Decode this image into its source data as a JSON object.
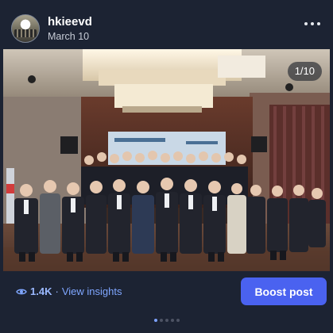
{
  "post": {
    "username": "hkieevd",
    "date": "March 10"
  },
  "photo": {
    "counter": "1/10"
  },
  "footer": {
    "views_count": "1.4K",
    "separator": "·",
    "insights_label": "View insights",
    "boost_label": "Boost post",
    "carousel_total": 5,
    "carousel_active": 1
  },
  "icons": {
    "avatar": "profile-avatar",
    "more": "more-horizontal-icon",
    "views": "eye-icon"
  },
  "colors": {
    "background": "#1c2333",
    "accent": "#4a62f0",
    "link": "#7fa6ff"
  }
}
